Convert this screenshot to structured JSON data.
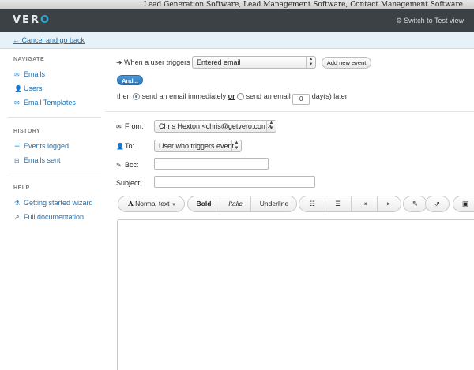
{
  "browser": {
    "title": "Lead Generation Software, Lead Management Software, Contact Management Software"
  },
  "header": {
    "logo_text": "VER",
    "logo_accent": "O",
    "switch_label": "Switch to Test view",
    "switch_icon": "gear-icon"
  },
  "cancel": {
    "label": "← Cancel and go back"
  },
  "sidebar": {
    "navigate": {
      "heading": "NAVIGATE",
      "items": [
        {
          "label": "Emails",
          "icon": "envelope-icon"
        },
        {
          "label": "Users",
          "icon": "user-icon"
        },
        {
          "label": "Email Templates",
          "icon": "envelope-icon"
        }
      ]
    },
    "history": {
      "heading": "HISTORY",
      "items": [
        {
          "label": "Events logged",
          "icon": "list-icon"
        },
        {
          "label": "Emails sent",
          "icon": "inbox-icon"
        }
      ]
    },
    "help": {
      "heading": "HELP",
      "items": [
        {
          "label": "Getting started wizard",
          "icon": "wizard-icon"
        },
        {
          "label": "Full documentation",
          "icon": "external-link-icon"
        }
      ]
    }
  },
  "trigger": {
    "prefix": "When a user triggers",
    "event_value": "Entered email",
    "add_event_label": "Add new event",
    "and_label": "And...",
    "then_label": "then",
    "option_immediate": "send an email immediately",
    "or_label": "or",
    "option_delay": "send an email",
    "delay_days": "0",
    "days_suffix": "day(s) later"
  },
  "email_form": {
    "from_label": "From:",
    "from_value": "Chris Hexton <chris@getvero.com>",
    "to_label": "To:",
    "to_value": "User who triggers event",
    "bcc_label": "Bcc:",
    "subject_label": "Subject:"
  },
  "toolbar": {
    "format_label": "Normal text",
    "bold_label": "Bold",
    "italic_label": "Italic",
    "underline_label": "Underline"
  }
}
